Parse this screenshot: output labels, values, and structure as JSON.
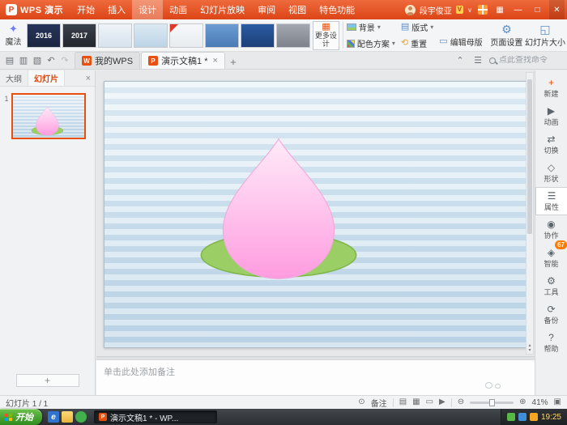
{
  "titlebar": {
    "logo_letter": "P",
    "logo_text": "WPS 演示",
    "menu": [
      "开始",
      "插入",
      "设计",
      "动画",
      "幻灯片放映",
      "审阅",
      "视图",
      "特色功能"
    ],
    "user_name": "段宇俊亚",
    "user_vip": "V",
    "user_caret": "∨"
  },
  "ribbon": {
    "magic": {
      "icon": "✦",
      "label": "魔法"
    },
    "templates": [
      {
        "label": "2016"
      },
      {
        "label": "2017"
      },
      {
        "label": ""
      },
      {
        "label": ""
      },
      {
        "label": ""
      },
      {
        "label": ""
      },
      {
        "label": ""
      },
      {
        "label": ""
      }
    ],
    "more_designs": "更多设计",
    "background_label": "背景",
    "color_scheme_label": "配色方案",
    "layout_label": "版式",
    "reset_label": "重置",
    "edit_master_label": "编辑母版",
    "page_setup_label": "页面设置",
    "slide_size_label": "幻灯片大小"
  },
  "tabbar": {
    "tabs": [
      {
        "icon_letter": "W",
        "label": "我的WPS"
      },
      {
        "icon_letter": "P",
        "label": "演示文稿1 *"
      }
    ],
    "search_placeholder": "点此查找命令"
  },
  "left_panel": {
    "outline_tab": "大纲",
    "slides_tab": "幻灯片",
    "slide_number": "1"
  },
  "notes_placeholder": "单击此处添加备注",
  "right_toolbar": {
    "items": [
      {
        "icon": "+",
        "label": "新建"
      },
      {
        "icon": "▶",
        "label": "动画"
      },
      {
        "icon": "⇄",
        "label": "切换"
      },
      {
        "icon": "◇",
        "label": "形状"
      },
      {
        "icon": "☰",
        "label": "属性"
      },
      {
        "icon": "◉",
        "label": "协作"
      },
      {
        "icon": "◈",
        "label": "智能",
        "badge": "67"
      },
      {
        "icon": "⚙",
        "label": "工具"
      },
      {
        "icon": "⟳",
        "label": "备份"
      },
      {
        "icon": "?",
        "label": "帮助"
      }
    ]
  },
  "statusbar": {
    "slide_info": "幻灯片 1 / 1",
    "notes_label": "备注",
    "zoom_percent": "41%"
  },
  "taskbar": {
    "start_label": "开始",
    "ie_letter": "e",
    "task_label": "演示文稿1 * - WP...",
    "clock": "19:25"
  },
  "icons": {
    "save": "▤",
    "open": "▥",
    "print": "▧",
    "undo": "↶",
    "redo": "↷",
    "collapse": "⌃",
    "list_menu": "☰",
    "minimize": "—",
    "maximize": "□",
    "close": "✕",
    "tab_close": "×",
    "new_tab": "+",
    "panel_close": "×",
    "dropdown": "▾",
    "more_designs_glyph": "▦",
    "layout_glyph": "▤",
    "reset_glyph": "⟲",
    "master_glyph": "▭",
    "page_setup_glyph": "⚙",
    "slide_size_glyph": "◱",
    "apps_grid": "▦",
    "record": "⊙",
    "zoom_out": "⊖",
    "zoom_in": "⊕",
    "view_normal": "▤",
    "view_sorter": "▦",
    "view_read": "▭",
    "view_show": "▶",
    "scroll_up": "▴",
    "scroll_down": "▾",
    "add_slide": "+",
    "fit": "▣"
  },
  "colors": {
    "titlebar_orange": "#e04a1e",
    "accent_orange": "#e8500f",
    "badge_orange": "#ff7a00",
    "leaf_green": "#9cce66",
    "peach_pink": "#ff9be0",
    "slide_top": "#eaf4fa",
    "slide_bottom": "#c2d8e9",
    "start_green": "#3fa32c"
  }
}
